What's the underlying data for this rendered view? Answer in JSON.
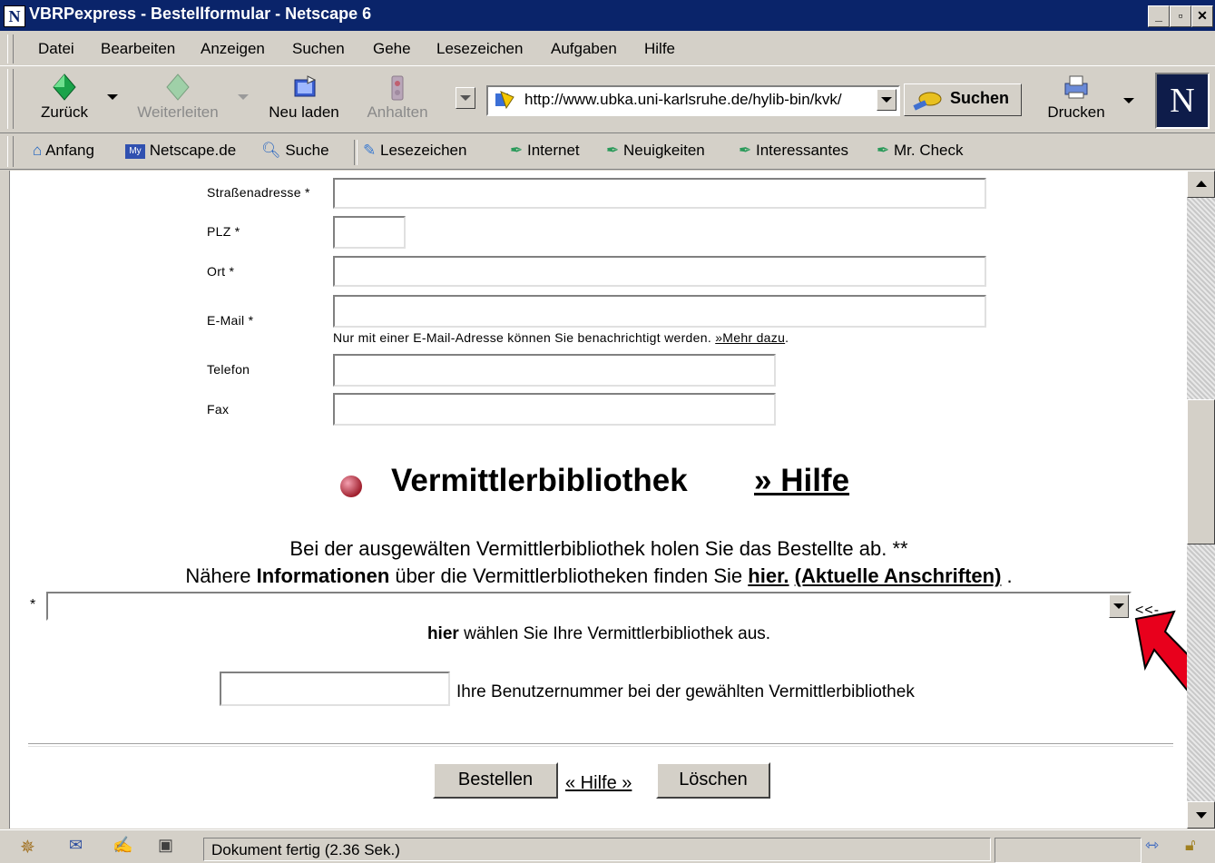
{
  "window": {
    "title": "VBRPexpress - Bestellformular - Netscape 6",
    "app_logo": "N"
  },
  "menu": {
    "items": [
      "Datei",
      "Bearbeiten",
      "Anzeigen",
      "Suchen",
      "Gehe",
      "Lesezeichen",
      "Aufgaben",
      "Hilfe"
    ]
  },
  "toolbar": {
    "back": "Zurück",
    "forward": "Weiterleiten",
    "reload": "Neu laden",
    "stop": "Anhalten",
    "url": "http://www.ubka.uni-karlsruhe.de/hylib-bin/kvk/",
    "search": "Suchen",
    "print": "Drucken",
    "logo": "N"
  },
  "personal": {
    "items": [
      "Anfang",
      "Netscape.de",
      "Suche",
      "Lesezeichen",
      "Internet",
      "Neuigkeiten",
      "Interessantes",
      "Mr. Check"
    ]
  },
  "form": {
    "street_label": "Straßenadresse *",
    "zip_label": "PLZ *",
    "city_label": "Ort *",
    "email_label": "E-Mail *",
    "email_note": "Nur mit einer E-Mail-Adresse können Sie benachrichtigt werden.",
    "email_more": "»Mehr dazu",
    "email_end": ".",
    "phone_label": "Telefon",
    "fax_label": "Fax"
  },
  "section": {
    "heading": "Vermittlerbibliothek",
    "help_link": "» Hilfe",
    "info_line1": "Bei der ausgewälten Vermittlerbibliothek holen Sie das Bestellte ab. **",
    "info_line2_pre": "Nähere ",
    "info_line2_bold": "Informationen",
    "info_line2_mid": " über die Vermittlerbliotheken finden Sie ",
    "info_link1": "hier.",
    "info_link2": "(Aktuelle Anschriften)",
    "info_line2_end": " .",
    "select_star": "*",
    "select_value": "",
    "arrow_marker": "<<-",
    "choose_bold": "hier",
    "choose_rest": " wählen Sie Ihre Vermittlerbibliothek aus.",
    "user_number_label": "Ihre Benutzernummer bei der gewählten Vermittlerbibliothek",
    "user_number_value": ""
  },
  "actions": {
    "order": "Bestellen",
    "help_link": "« Hilfe »",
    "delete": "Löschen"
  },
  "status": {
    "text": "Dokument fertig (2.36 Sek.)"
  },
  "colors": {
    "titlebar": "#0a246a",
    "chrome": "#d4d0c8",
    "arrow": "#e8001c"
  }
}
